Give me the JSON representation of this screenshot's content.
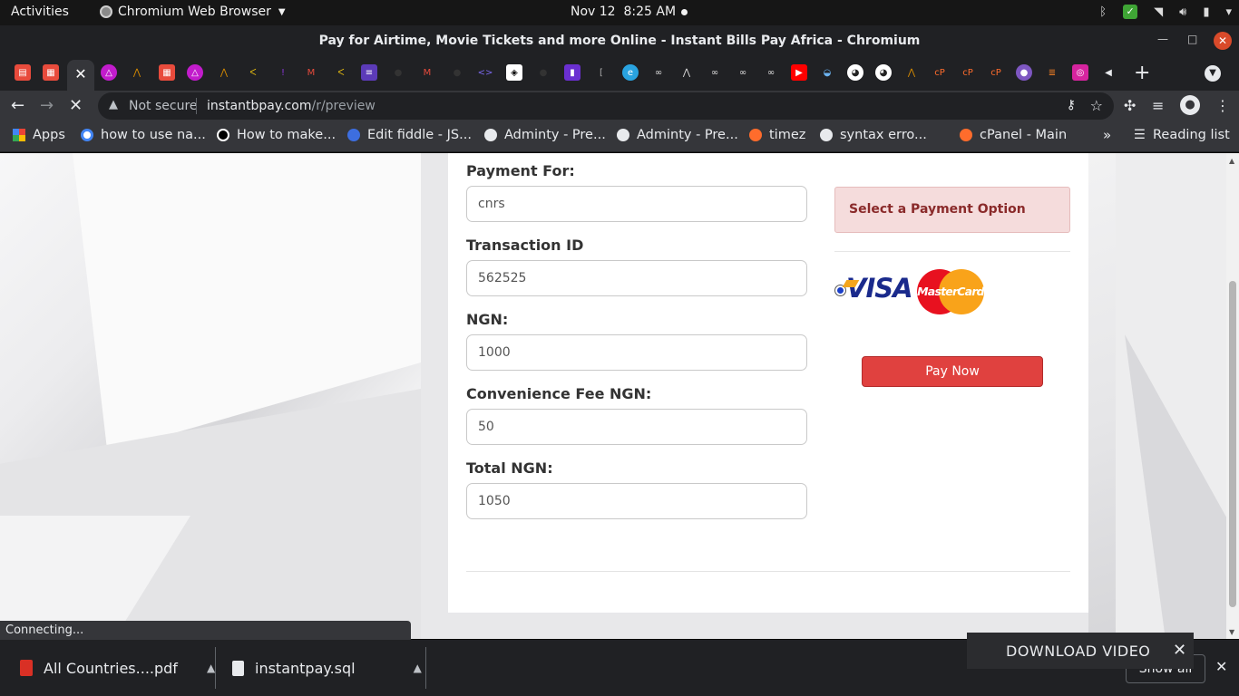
{
  "system": {
    "activities": "Activities",
    "app_name": "Chromium Web Browser",
    "date": "Nov 12",
    "time": "8:25 AM"
  },
  "window": {
    "title": "Pay for Airtime, Movie Tickets and more Online - Instant Bills Pay Africa - Chromium"
  },
  "tabs": {
    "count_visible": 40,
    "active_close": "✕"
  },
  "address_bar": {
    "security": "Not secure",
    "domain": "instantbpay.com",
    "path": "/r/preview"
  },
  "bookmarks": [
    {
      "label": "Apps",
      "color": "#ea4335"
    },
    {
      "label": "how to use na...",
      "color": "#4285f4"
    },
    {
      "label": "How to make...",
      "color": "#000000"
    },
    {
      "label": "Edit fiddle - JS...",
      "color": "#3d6ee0"
    },
    {
      "label": "Adminty - Pre...",
      "color": "#e8eaed"
    },
    {
      "label": "Adminty - Pre...",
      "color": "#e8eaed"
    },
    {
      "label": "timez",
      "color": "#ff6c2c"
    },
    {
      "label": "syntax erro...",
      "color": "#e8eaed"
    },
    {
      "label": "cPanel - Main",
      "color": "#ff6c2c"
    }
  ],
  "reading_list": "Reading list",
  "form": {
    "payment_for": {
      "label": "Payment For:",
      "value": "cnrs"
    },
    "transaction_id": {
      "label": "Transaction ID",
      "value": "562525"
    },
    "ngn": {
      "label": "NGN:",
      "value": "1000"
    },
    "convenience_fee": {
      "label": "Convenience Fee NGN:",
      "value": "50"
    },
    "total": {
      "label": "Total NGN:",
      "value": "1050"
    }
  },
  "payment": {
    "option_title": "Select a Payment Option",
    "visa_text": "VISA",
    "mastercard_text": "MasterCard",
    "pay_button": "Pay Now",
    "selected": true
  },
  "status_text": "Connecting...",
  "downloads": {
    "items": [
      {
        "name": "All Countries....pdf"
      },
      {
        "name": "instantpay.sql"
      }
    ],
    "show_all": "Show all"
  },
  "download_video": "DOWNLOAD VIDEO",
  "colors": {
    "accent_button": "#e0413f",
    "alert_bg": "#f5dcdc",
    "alert_text": "#8a2a2a"
  }
}
